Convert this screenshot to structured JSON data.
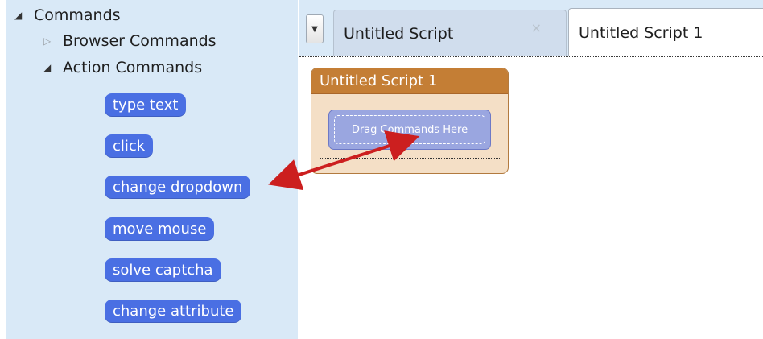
{
  "sidebar": {
    "root_label": "Commands",
    "groups": [
      {
        "label": "Browser Commands",
        "expanded": false
      },
      {
        "label": "Action Commands",
        "expanded": true
      }
    ],
    "commands": [
      "type text",
      "click",
      "change dropdown",
      "move mouse",
      "solve captcha",
      "change attribute"
    ]
  },
  "tabs": [
    {
      "label": "Untitled Script",
      "active": false,
      "close_glyph": "×"
    },
    {
      "label": "Untitled Script 1",
      "active": true
    }
  ],
  "script_block": {
    "title": "Untitled Script 1",
    "drop_zone_text": "Drag Commands Here"
  },
  "icons": {
    "expanded": "expanded-triangle-icon",
    "collapsed": "collapsed-triangle-icon",
    "tab_dropdown": "chevron-down-icon"
  },
  "colors": {
    "sidebar_bg": "#d9e9f7",
    "command_pill": "#4a6fe3",
    "script_header": "#c47e35",
    "script_body": "#f4dfc6",
    "drop_zone": "#9aa6e0",
    "annotation_arrow": "#cc1f1f"
  }
}
